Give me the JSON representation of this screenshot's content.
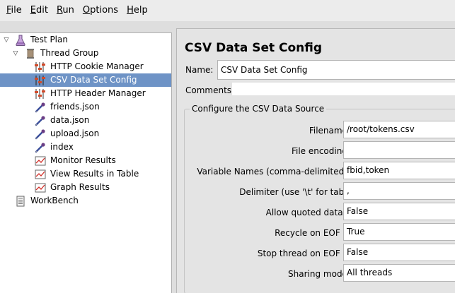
{
  "menu": [
    {
      "mnemonic": "F",
      "rest": "ile"
    },
    {
      "mnemonic": "E",
      "rest": "dit"
    },
    {
      "mnemonic": "R",
      "rest": "un"
    },
    {
      "mnemonic": "O",
      "rest": "ptions"
    },
    {
      "mnemonic": "H",
      "rest": "elp"
    }
  ],
  "tree": {
    "items": [
      {
        "label": "Test Plan",
        "icon": "flask-icon"
      },
      {
        "label": "Thread Group",
        "icon": "spool-icon"
      },
      {
        "label": "HTTP Cookie Manager",
        "icon": "config-element-icon"
      },
      {
        "label": "CSV Data Set Config",
        "icon": "config-element-icon"
      },
      {
        "label": "HTTP Header Manager",
        "icon": "config-element-icon"
      },
      {
        "label": "friends.json",
        "icon": "sampler-pipette-icon"
      },
      {
        "label": "data.json",
        "icon": "sampler-pipette-icon"
      },
      {
        "label": "upload.json",
        "icon": "sampler-pipette-icon"
      },
      {
        "label": "index",
        "icon": "sampler-pipette-icon"
      },
      {
        "label": "Monitor Results",
        "icon": "listener-chart-icon"
      },
      {
        "label": "View Results in Table",
        "icon": "listener-chart-icon"
      },
      {
        "label": "Graph Results",
        "icon": "listener-chart-icon"
      },
      {
        "label": "WorkBench",
        "icon": "workbench-icon"
      }
    ],
    "selected_color": "#6e93c6"
  },
  "panel": {
    "title": "CSV Data Set Config",
    "name_label": "Name:",
    "name_value": "CSV Data Set Config",
    "comments_label": "Comments:",
    "group_title": "Configure the CSV Data Source",
    "fields": [
      {
        "label": "Filename:",
        "value": "/root/tokens.csv"
      },
      {
        "label": "File encoding:",
        "value": ""
      },
      {
        "label": "Variable Names (comma-delimited):",
        "value": "fbid,token"
      },
      {
        "label": "Delimiter (use '\\t' for tab):",
        "value": ","
      },
      {
        "label": "Allow quoted data?:",
        "value": "False"
      },
      {
        "label": "Recycle on EOF ?:",
        "value": "True"
      },
      {
        "label": "Stop thread on EOF ?:",
        "value": "False"
      },
      {
        "label": "Sharing mode:",
        "value": "All threads"
      }
    ]
  }
}
